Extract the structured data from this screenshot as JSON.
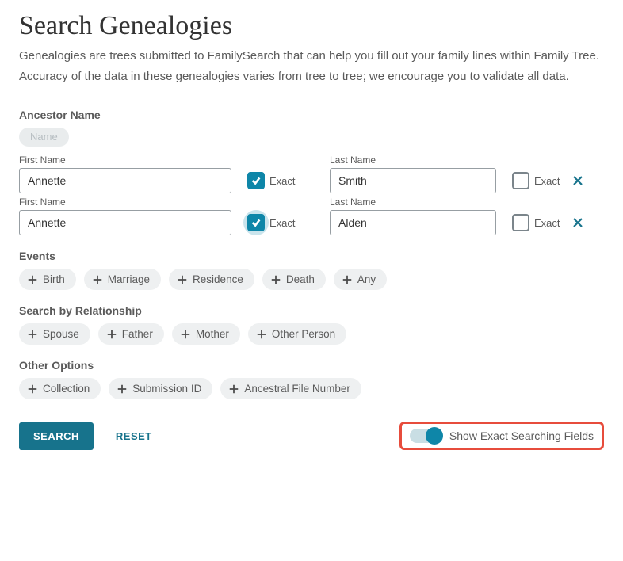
{
  "header": {
    "title": "Search Genealogies",
    "description": "Genealogies are trees submitted to FamilySearch that can help you fill out your family lines within Family Tree. Accuracy of the data in these genealogies varies from tree to tree; we encourage you to validate all data."
  },
  "ancestor": {
    "section_label": "Ancestor Name",
    "name_chip_label": "Name",
    "first_name_label": "First Name",
    "last_name_label": "Last Name",
    "exact_label": "Exact",
    "rows": [
      {
        "first_name": "Annette",
        "first_exact": true,
        "first_exact_halo": false,
        "last_name": "Smith",
        "last_exact": false
      },
      {
        "first_name": "Annette",
        "first_exact": true,
        "first_exact_halo": true,
        "last_name": "Alden",
        "last_exact": false
      }
    ]
  },
  "events": {
    "label": "Events",
    "chips": [
      "Birth",
      "Marriage",
      "Residence",
      "Death",
      "Any"
    ]
  },
  "relationship": {
    "label": "Search by Relationship",
    "chips": [
      "Spouse",
      "Father",
      "Mother",
      "Other Person"
    ]
  },
  "other": {
    "label": "Other Options",
    "chips": [
      "Collection",
      "Submission ID",
      "Ancestral File Number"
    ]
  },
  "footer": {
    "search_label": "SEARCH",
    "reset_label": "RESET",
    "toggle_label": "Show Exact Searching Fields",
    "toggle_on": true
  }
}
